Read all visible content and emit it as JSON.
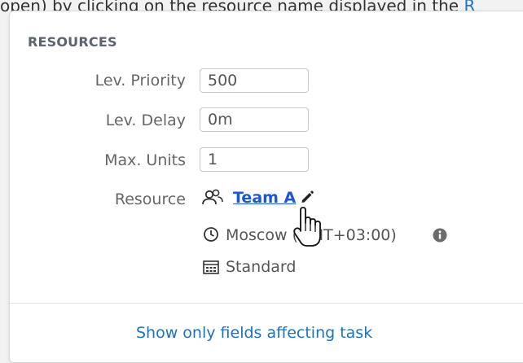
{
  "doc_text": {
    "prefix": "open) by clicking on the resource name displayed in the ",
    "link": "R"
  },
  "panel": {
    "section_title": "RESOURCES",
    "fields": [
      {
        "label": "Lev. Priority",
        "value": "500"
      },
      {
        "label": "Lev. Delay",
        "value": "0m"
      },
      {
        "label": "Max. Units",
        "value": "1"
      }
    ],
    "resource": {
      "label": "Resource",
      "name": "Team A",
      "timezone": "Moscow (GMT+03:00)",
      "calendar": "Standard"
    },
    "footer_link": "Show only fields affecting task"
  },
  "colors": {
    "link": "#1a73c7",
    "resource_link": "#1a56d6"
  },
  "icons": [
    "group-icon",
    "pencil-icon",
    "clock-icon",
    "info-icon",
    "calendar-icon",
    "hand-pointer-icon"
  ]
}
